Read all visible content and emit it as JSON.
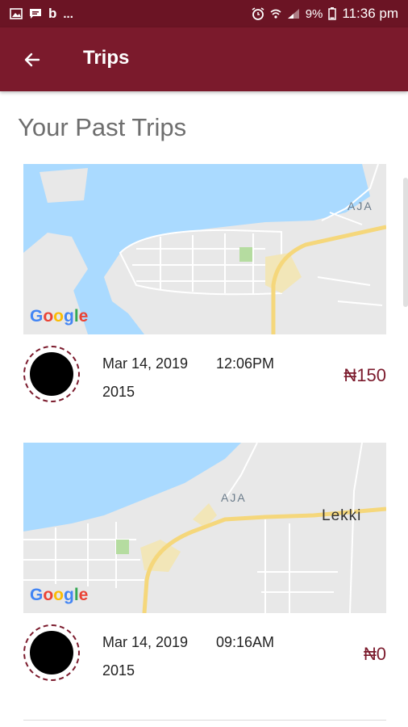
{
  "status_bar": {
    "left_icons": [
      "image-icon",
      "message-icon",
      "b-app-icon"
    ],
    "overflow": "...",
    "battery": "9%",
    "time": "11:36 pm"
  },
  "app_bar": {
    "title": "Trips",
    "back_icon": "arrow-left-icon"
  },
  "section_title": "Your Past Trips",
  "trips": [
    {
      "map_labels": {
        "place": "AJA",
        "google": "Google"
      },
      "date": "Mar 14, 2019",
      "time": "12:06PM",
      "number": "2015",
      "price": "₦150"
    },
    {
      "map_labels": {
        "place": "AJA",
        "area": "Lekki",
        "google": "Google"
      },
      "date": "Mar 14, 2019",
      "time": "09:16AM",
      "number": "2015",
      "price": "₦0"
    }
  ],
  "colors": {
    "primary": "#7b1a2c",
    "status_bar": "#6b1424",
    "water": "#aadaff",
    "land": "#e8e8e8",
    "road": "#f5d77b"
  }
}
